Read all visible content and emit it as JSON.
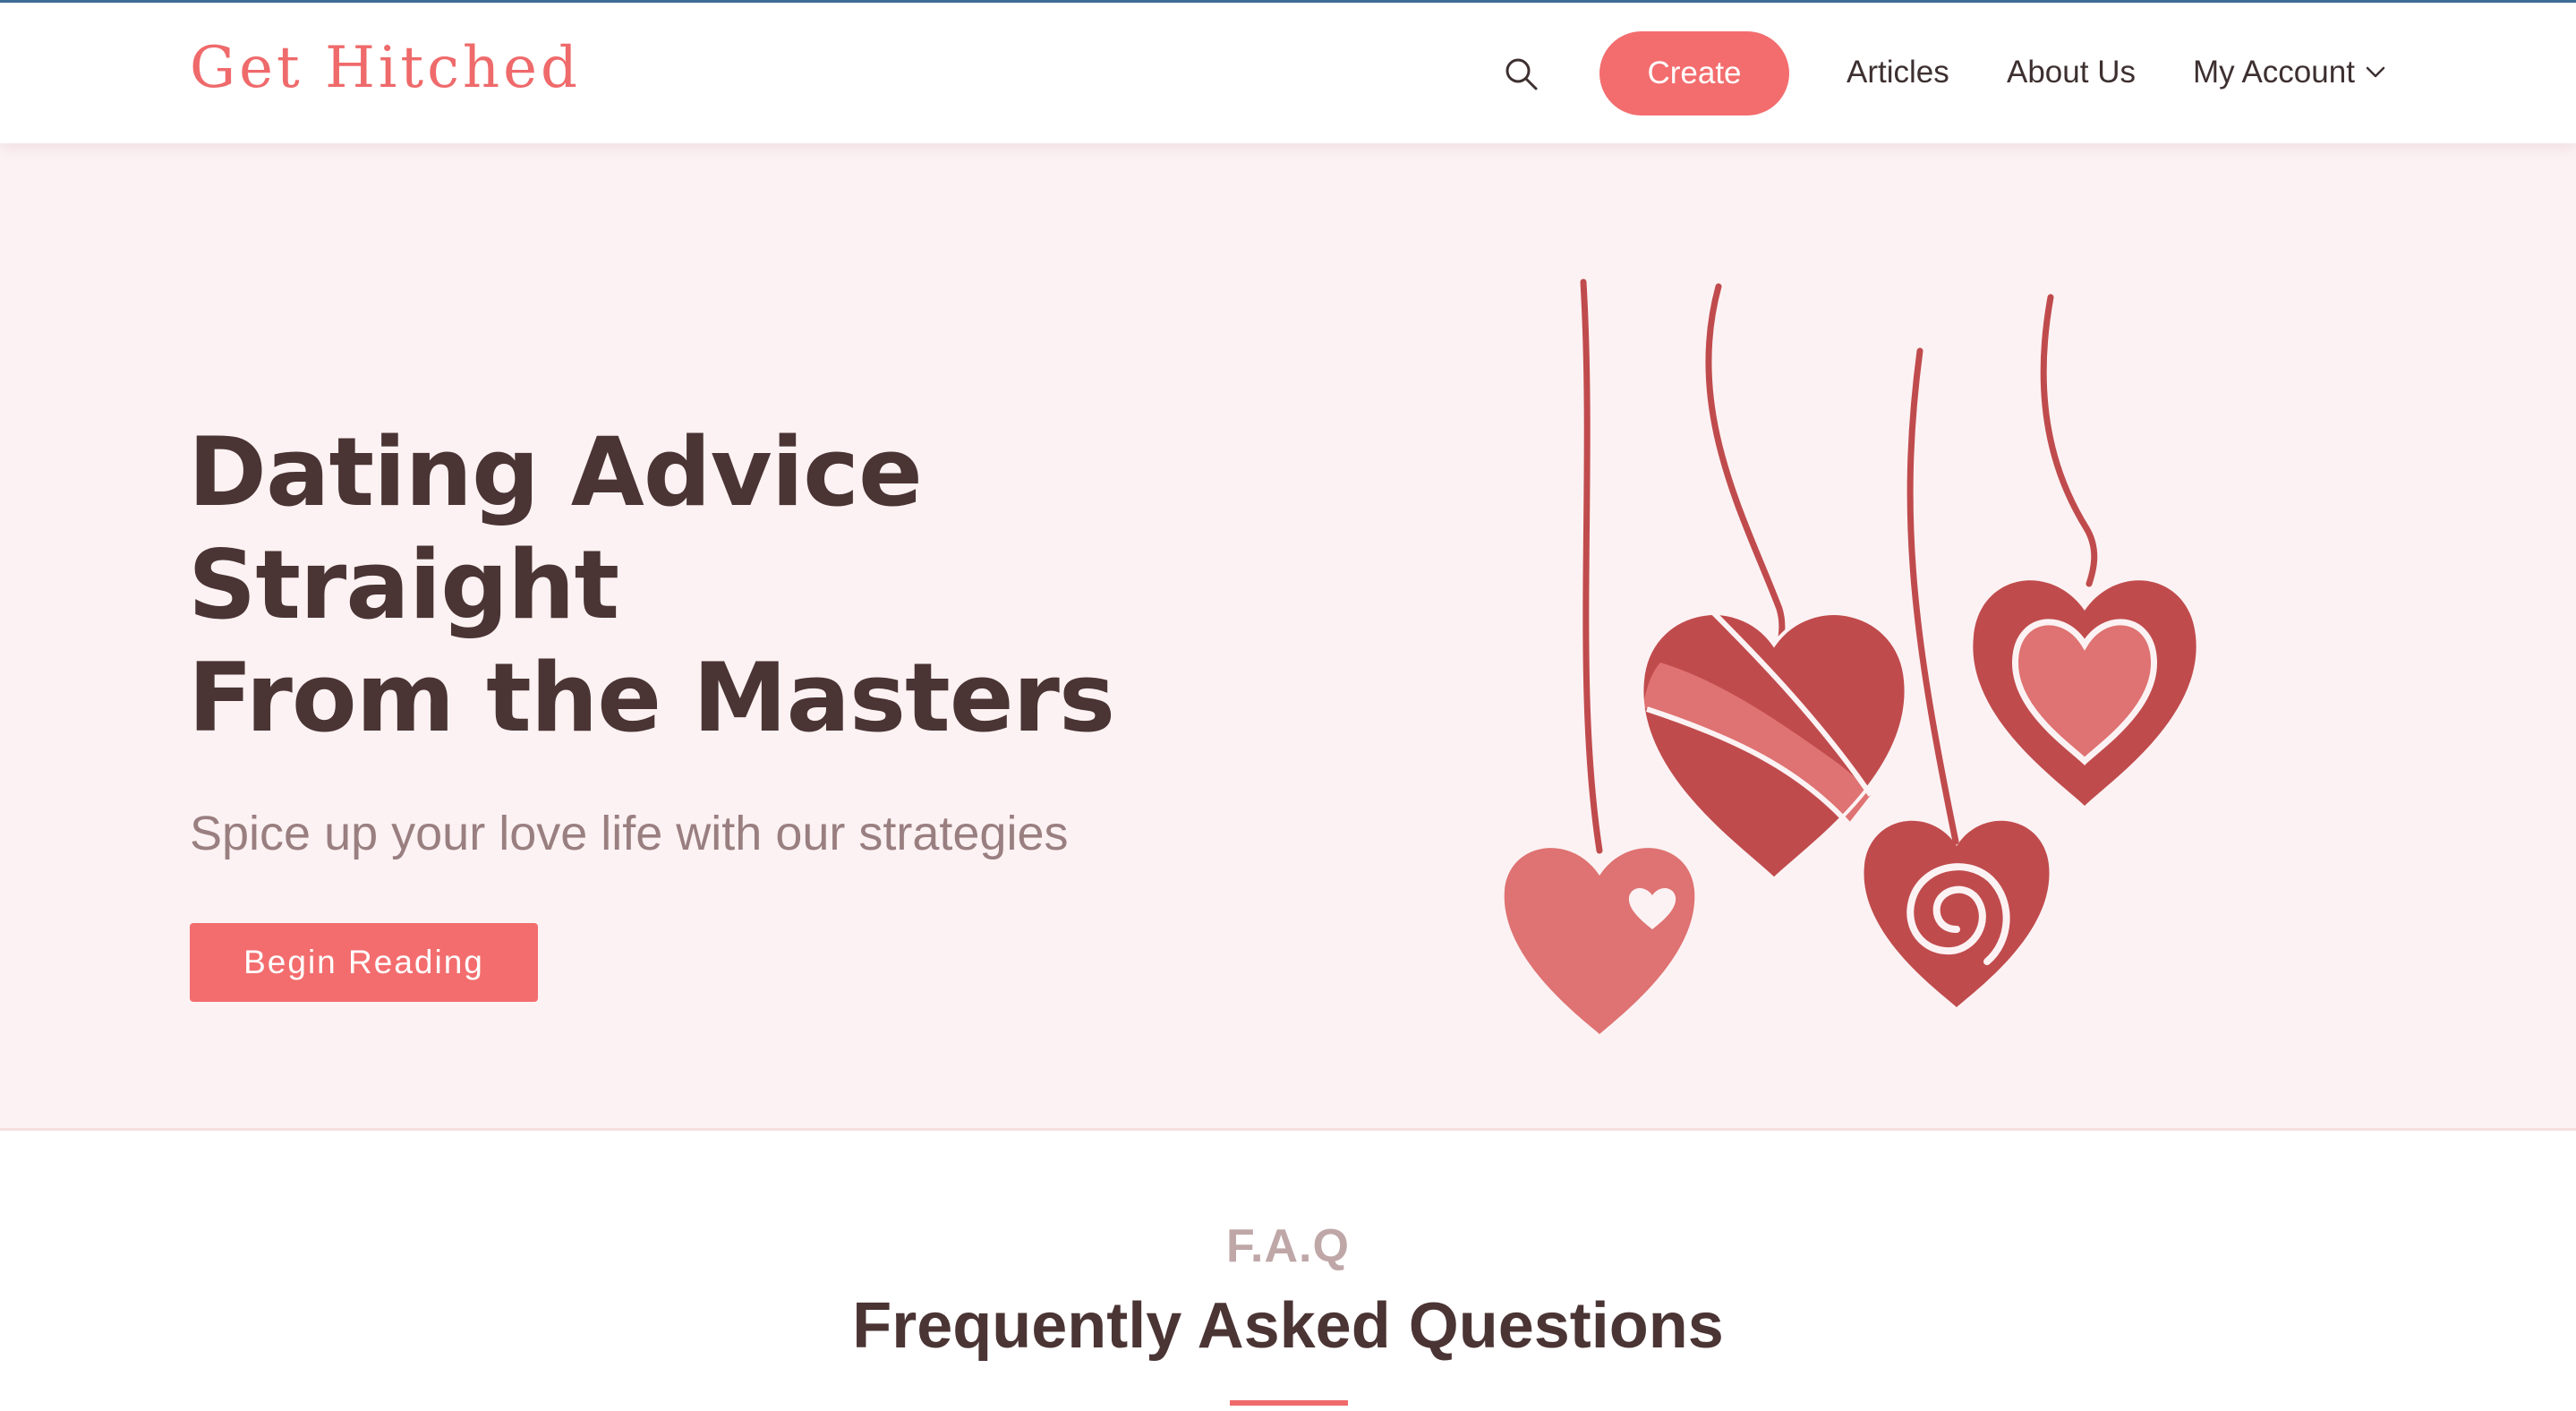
{
  "header": {
    "brand": "Get Hitched",
    "create_label": "Create",
    "nav": {
      "articles": "Articles",
      "about": "About Us",
      "account": "My Account"
    }
  },
  "hero": {
    "title_line1": "Dating Advice Straight",
    "title_line2": "From the Masters",
    "subtitle": "Spice up your love life with our strategies",
    "cta_label": "Begin Reading"
  },
  "faq": {
    "eyebrow": "F.A.Q",
    "title": "Frequently Asked Questions"
  },
  "colors": {
    "brand": "#ef6a6b",
    "hero_background": "#fcf2f3",
    "heading_text": "#4b3434",
    "heart_dark": "#c04b4d",
    "heart_light": "#df7272"
  },
  "icons": {
    "search": "search-icon",
    "dropdown": "chevron-down-icon",
    "hero_illustration": "hanging-hearts-illustration"
  }
}
